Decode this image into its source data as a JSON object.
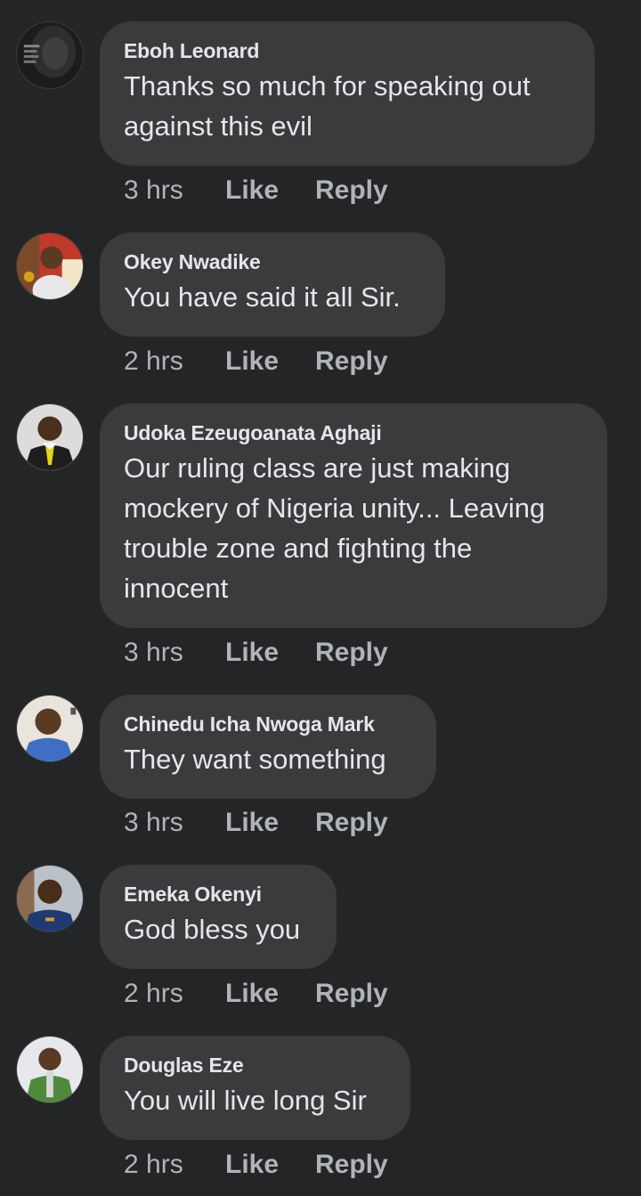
{
  "comments": [
    {
      "author": "Eboh Leonard",
      "text": "Thanks so much for speaking out against this evil",
      "time": "3 hrs",
      "like": "Like",
      "reply": "Reply",
      "avatar_icon": "lion-quote-avatar"
    },
    {
      "author": "Okey Nwadike",
      "text": "You have said it all Sir.",
      "time": "2 hrs",
      "like": "Like",
      "reply": "Reply",
      "avatar_icon": "man-portrait-avatar"
    },
    {
      "author": "Udoka Ezeugoanata Aghaji",
      "text": "Our ruling class are just making mockery of Nigeria unity... Leaving trouble zone and fighting the innocent",
      "time": "3 hrs",
      "like": "Like",
      "reply": "Reply",
      "avatar_icon": "man-suit-avatar"
    },
    {
      "author": "Chinedu Icha Nwoga Mark",
      "text": "They want something",
      "time": "3 hrs",
      "like": "Like",
      "reply": "Reply",
      "avatar_icon": "man-blue-shirt-avatar"
    },
    {
      "author": "Emeka Okenyi",
      "text": "God bless you",
      "time": "2 hrs",
      "like": "Like",
      "reply": "Reply",
      "avatar_icon": "man-portrait-avatar"
    },
    {
      "author": "Douglas Eze",
      "text": "You will live long Sir",
      "time": "2 hrs",
      "like": "Like",
      "reply": "Reply",
      "avatar_icon": "man-portrait-avatar"
    }
  ],
  "colors": {
    "background": "#242526",
    "bubble": "#3a3b3c",
    "primary_text": "#e4e6eb",
    "secondary_text": "#b0b3b8"
  }
}
